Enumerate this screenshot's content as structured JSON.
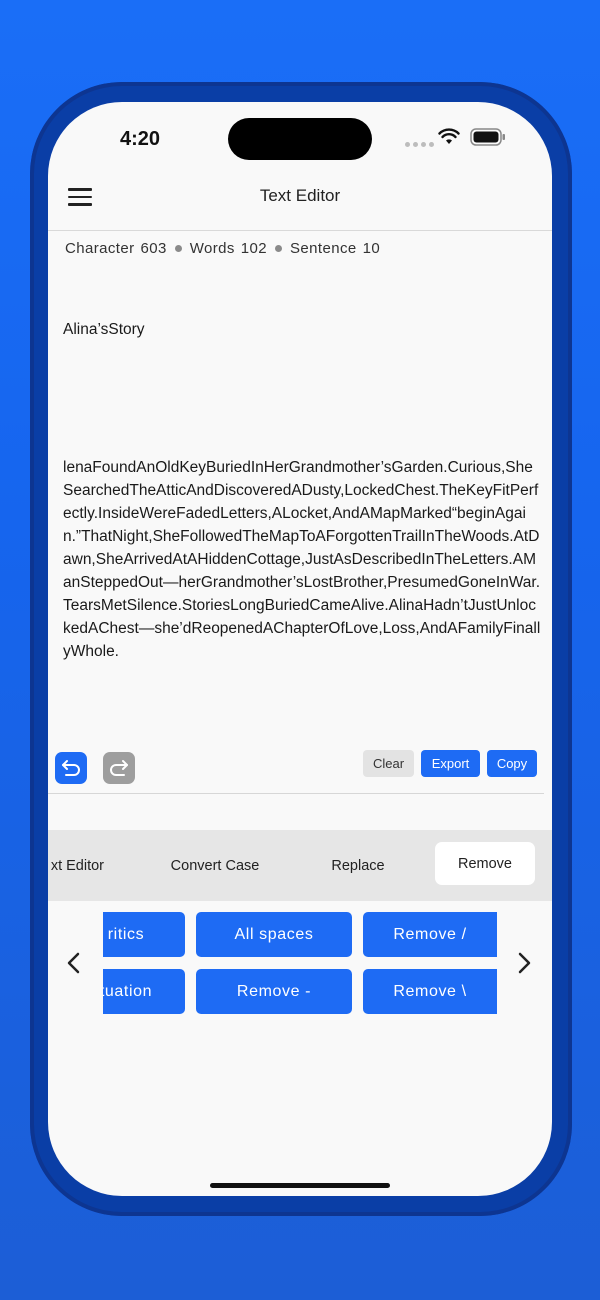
{
  "status_bar": {
    "time": "4:20"
  },
  "header": {
    "title": "Text Editor"
  },
  "stats": {
    "character_label": "Character",
    "character_count": "603",
    "words_label": "Words",
    "words_count": "102",
    "sentence_label": "Sentence",
    "sentence_count": "10"
  },
  "editor": {
    "title_line": "Alina’sStory",
    "body": "lenaFoundAnOldKeyBuriedInHerGrandmother’sGarden.Curious,SheSearchedTheAtticAndDiscoveredADusty,LockedChest.TheKeyFitPerfectly.InsideWereFadedLetters,ALocket,AndAMapMarked“beginAgain.”ThatNight,SheFollowedTheMapToAForgottenTrailInTheWoods.AtDawn,SheArrivedAtAHiddenCottage,JustAsDescribedInTheLetters.AManSteppedOut—herGrandmother’sLostBrother,PresumedGoneInWar.TearsMetSilence.StoriesLongBuriedCameAlive.AlinaHadn’tJustUnlockedAChest—she’dReopenedAChapterOfLove,Loss,AndAFamilyFinallyWhole."
  },
  "actions": {
    "clear": "Clear",
    "export": "Export",
    "copy": "Copy"
  },
  "tabs": {
    "text_editor": "xt Editor",
    "convert_case": "Convert Case",
    "replace": "Replace",
    "remove": "Remove"
  },
  "tools": {
    "diacritics": "ritics",
    "punctuation": "tuation",
    "all_spaces": "All spaces",
    "remove_dash": "Remove -",
    "remove_slash": "Remove /",
    "remove_backslash": "Remove \\"
  },
  "colors": {
    "accent": "#1e6bf4",
    "background": "#1a6ef7",
    "frame": "#0a3ea6"
  }
}
